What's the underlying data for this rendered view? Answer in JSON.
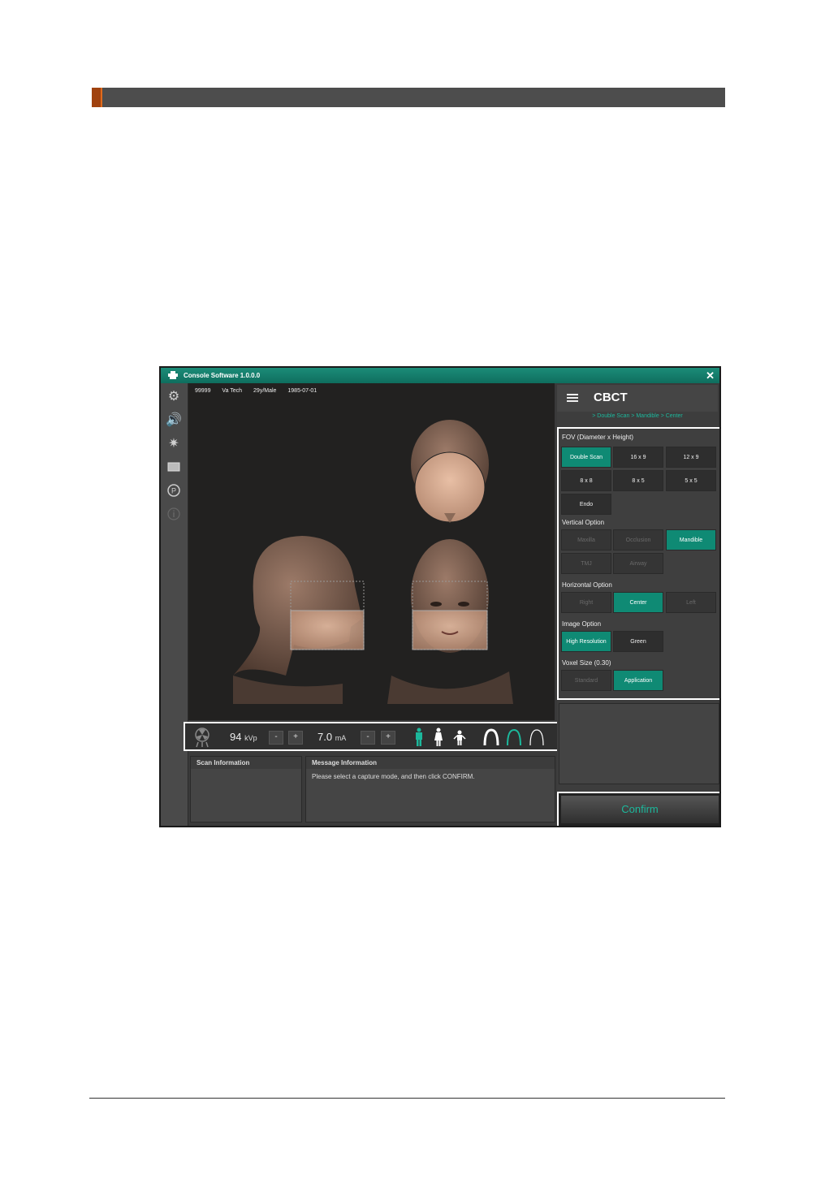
{
  "window": {
    "title": "Console Software  1.0.0.0",
    "close_glyph": "✕"
  },
  "patient": {
    "id": "99999",
    "name": "Va Tech",
    "age_sex": "29y/Male",
    "dob": "1985-07-01"
  },
  "sidebar": {
    "icons": [
      "gear-icon",
      "speaker-icon",
      "sun-icon",
      "monitor-icon",
      "p-target-icon",
      "info-icon"
    ]
  },
  "controls": {
    "kvp_value": "94",
    "kvp_unit": "kVp",
    "ma_value": "7.0",
    "ma_unit": "mA",
    "minus": "-",
    "plus": "+"
  },
  "info_panels": {
    "scan_header": "Scan Information",
    "message_header": "Message Information",
    "message_text": "Please select a capture mode, and then click CONFIRM."
  },
  "right_panel": {
    "mode": "CBCT",
    "breadcrumb": "> Double Scan > Mandible > Center",
    "fov_label": "FOV (Diameter x Height)",
    "fov": [
      "Double Scan",
      "16 x 9",
      "12 x 9",
      "8 x 8",
      "8 x 5",
      "5 x 5",
      "Endo"
    ],
    "vertical_label": "Vertical Option",
    "vertical": [
      "Maxilla",
      "Occlusion",
      "Mandible",
      "TMJ",
      "Airway"
    ],
    "horizontal_label": "Horizontal Option",
    "horizontal": [
      "Right",
      "Center",
      "Left"
    ],
    "image_label": "Image Option",
    "image": [
      "High Resolution",
      "Green"
    ],
    "voxel_label": "Voxel Size (0.30)",
    "voxel": [
      "Standard",
      "Application"
    ],
    "confirm": "Confirm"
  },
  "colors": {
    "accent": "#0f8a74",
    "section_accent": "#a0420f"
  }
}
